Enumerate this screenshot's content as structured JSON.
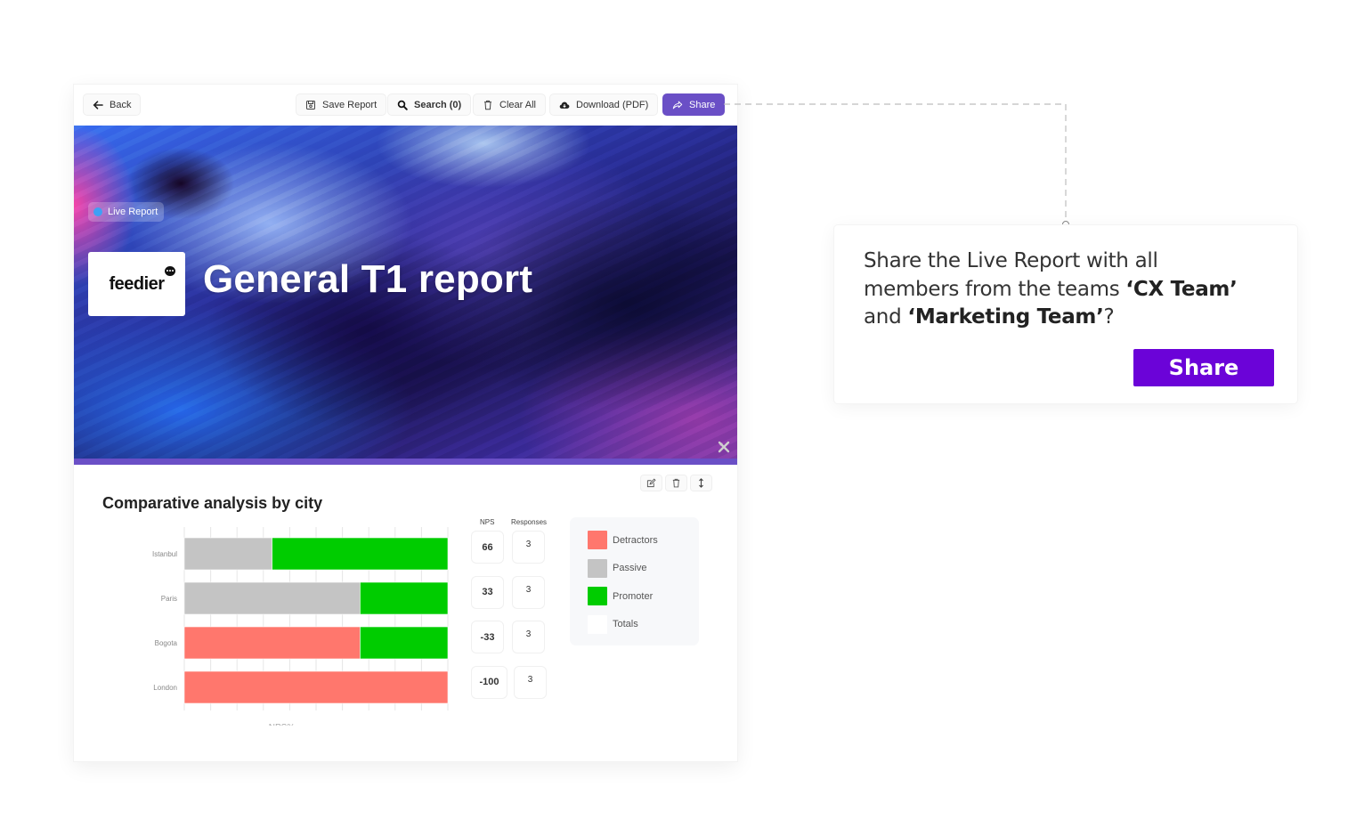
{
  "toolbar": {
    "back_label": "Back",
    "save_label": "Save Report",
    "search_label": "Search (0)",
    "clear_label": "Clear All",
    "download_label": "Download (PDF)",
    "share_label": "Share",
    "accent_color": "#6a4fc6"
  },
  "hero": {
    "badge_label": "Live Report",
    "badge_dot_color": "#3fa0f5",
    "logo_text": "feedier",
    "title": "General T1 report"
  },
  "widget": {
    "title": "Comparative analysis by city",
    "actions": [
      "edit",
      "delete",
      "reorder"
    ]
  },
  "stats": {
    "nps_header": "NPS",
    "responses_header": "Responses",
    "rows": [
      {
        "city": "Istanbul",
        "nps": "66",
        "responses": "3"
      },
      {
        "city": "Paris",
        "nps": "33",
        "responses": "3"
      },
      {
        "city": "Bogota",
        "nps": "-33",
        "responses": "3"
      },
      {
        "city": "London",
        "nps": "-100",
        "responses": "3"
      }
    ]
  },
  "legend": {
    "items": [
      {
        "label": "Detractors",
        "color": "#ff776d"
      },
      {
        "label": "Passive",
        "color": "#c4c4c4"
      },
      {
        "label": "Promoter",
        "color": "#00cc00"
      },
      {
        "label": "Totals",
        "color": "#ffffff"
      }
    ]
  },
  "chart_data": {
    "type": "bar",
    "orientation": "horizontal",
    "stacked": true,
    "title": "Comparative analysis by city",
    "xlabel": "NPS%",
    "ylabel": "",
    "categories": [
      "Istanbul",
      "Paris",
      "Bogota",
      "London"
    ],
    "series": [
      {
        "name": "Detractors",
        "color": "#ff776d",
        "values": [
          0,
          0,
          66.7,
          100
        ]
      },
      {
        "name": "Passive",
        "color": "#c4c4c4",
        "values": [
          33.3,
          66.7,
          0,
          0
        ]
      },
      {
        "name": "Promoter",
        "color": "#00cc00",
        "values": [
          66.7,
          33.3,
          33.3,
          0
        ]
      }
    ],
    "xlim": [
      0,
      100
    ],
    "x_tick_count": 10,
    "grid": true,
    "legend": "right"
  },
  "share_dialog": {
    "text_prefix": "Share the Live Report with all members from the teams ",
    "team_1": "‘CX Team’",
    "text_middle": " and ",
    "team_2": "‘Marketing Team’",
    "text_suffix": "?",
    "button_label": "Share",
    "button_color": "#6b03d8"
  }
}
